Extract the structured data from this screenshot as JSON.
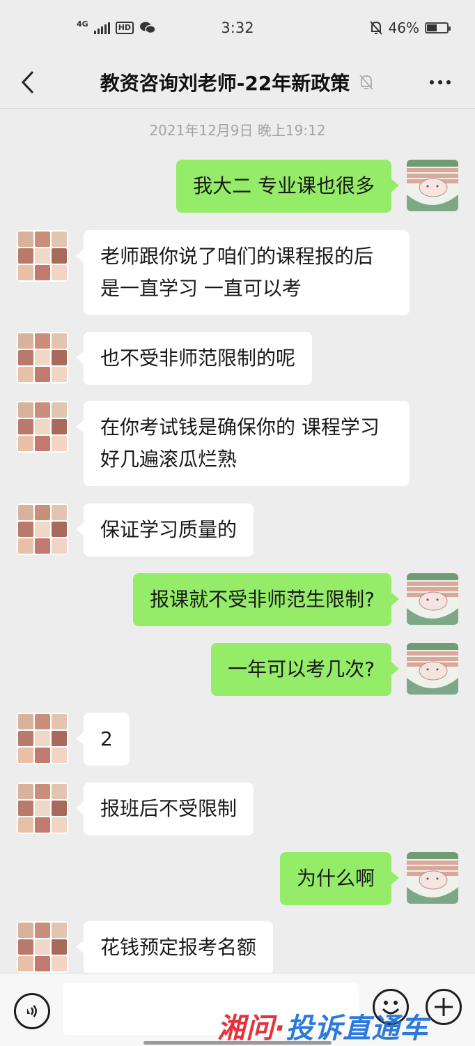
{
  "status_bar": {
    "network": "4G",
    "hd": "HD",
    "time": "3:32",
    "battery": "46%",
    "battery_level": 0.46
  },
  "header": {
    "title": "教资咨询刘老师-22年新政策"
  },
  "chat": {
    "timestamp": "2021年12月9日 晚上19:12",
    "messages": [
      {
        "side": "right",
        "text": "我大二 专业课也很多"
      },
      {
        "side": "left",
        "text": "老师跟你说了咱们的课程报的后 是一直学习 一直可以考"
      },
      {
        "side": "left",
        "text": "也不受非师范限制的呢"
      },
      {
        "side": "left",
        "text": "在你考试钱是确保你的 课程学习好几遍滚瓜烂熟"
      },
      {
        "side": "left",
        "text": "保证学习质量的"
      },
      {
        "side": "right",
        "text": "报课就不受非师范生限制?"
      },
      {
        "side": "right",
        "text": "一年可以考几次?"
      },
      {
        "side": "left",
        "text": "2"
      },
      {
        "side": "left",
        "text": "报班后不受限制"
      },
      {
        "side": "right",
        "text": "为什么啊"
      },
      {
        "side": "left",
        "text": "花钱预定报考名额"
      }
    ]
  },
  "input_bar": {
    "value": ""
  },
  "watermark": {
    "part1": "湘问·",
    "part2": "投诉直通车"
  },
  "colors": {
    "background": "#ededed",
    "bubble_self": "#95ec69",
    "bubble_other": "#ffffff"
  }
}
